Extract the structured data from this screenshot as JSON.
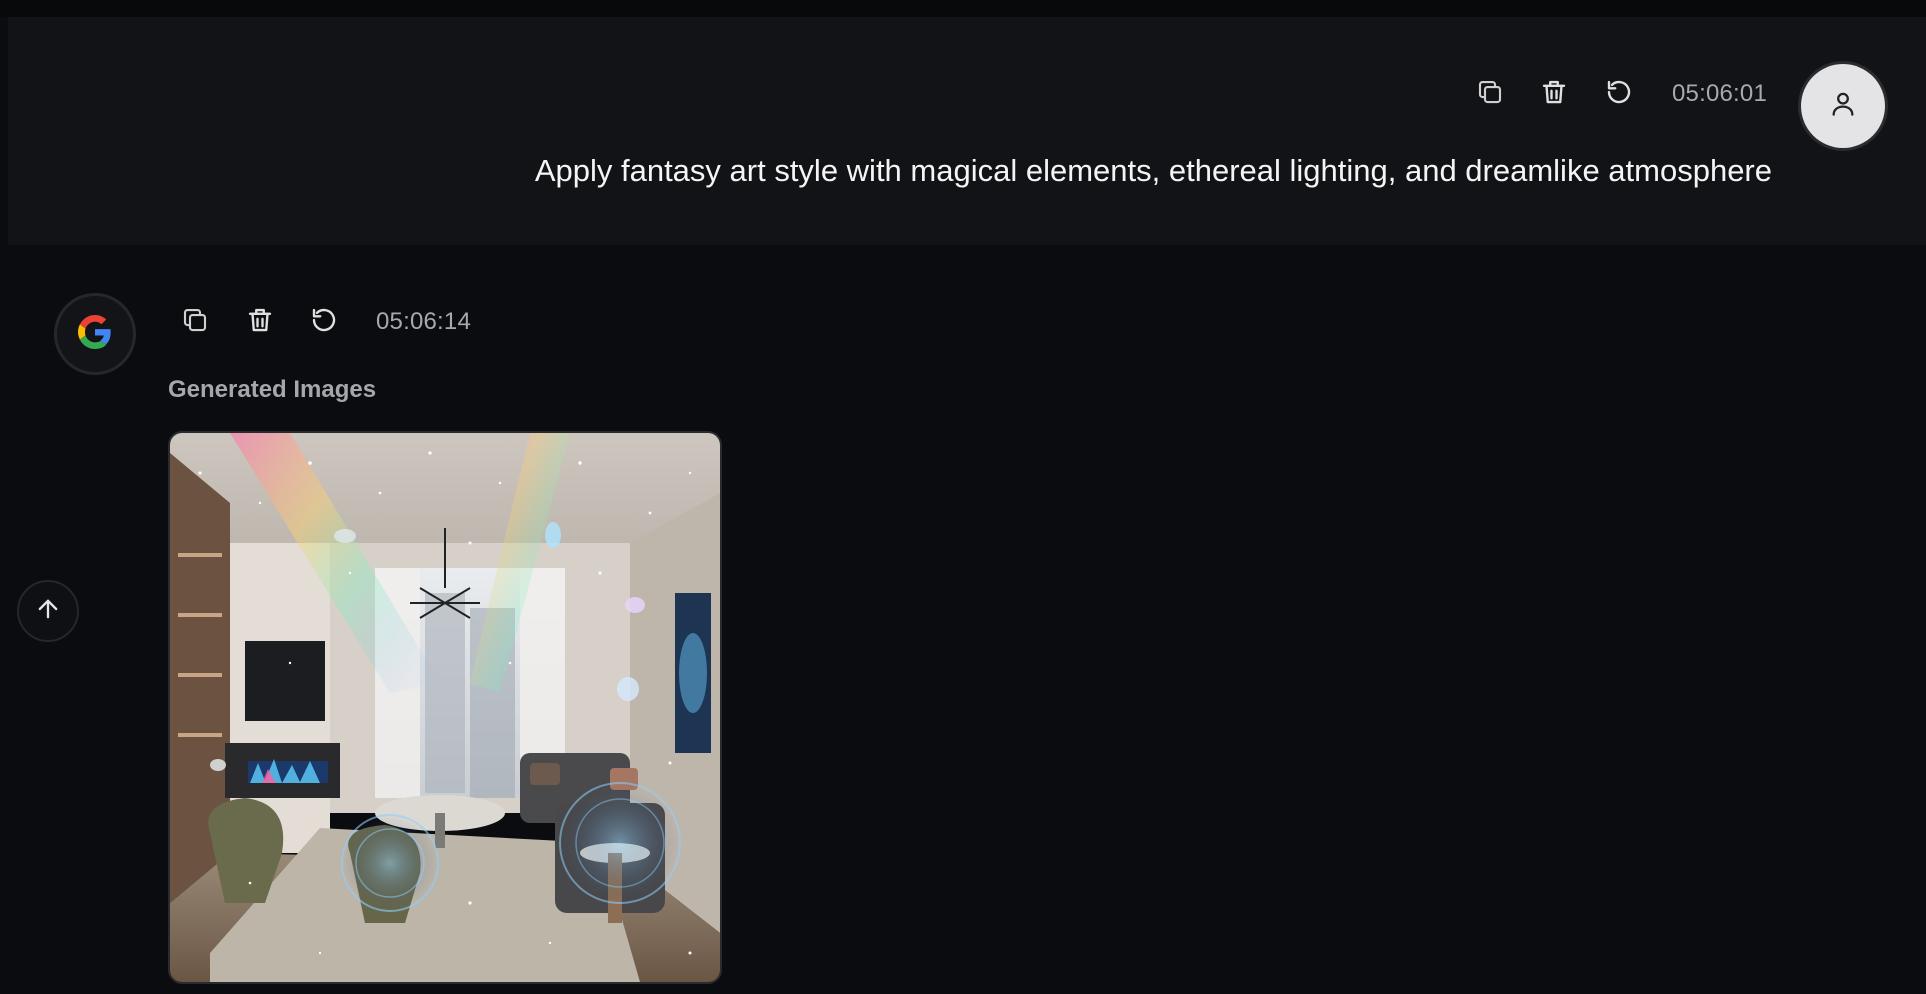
{
  "user_message": {
    "text": "Apply fantasy art style with magical elements, ethereal lighting, and dreamlike atmosphere",
    "timestamp": "05:06:01",
    "actions": {
      "copy_icon": "copy-icon",
      "delete_icon": "trash-icon",
      "retry_icon": "refresh-icon"
    },
    "avatar_icon": "user-icon"
  },
  "assistant_message": {
    "timestamp": "05:06:14",
    "avatar_icon": "google-logo",
    "section_label": "Generated Images",
    "image_description_icon": "generated-image"
  },
  "scroll_button_icon": "arrow-up-icon",
  "colors": {
    "background": "#0b0c0f",
    "user_bubble": "#121316",
    "text": "#f5f5f5",
    "muted": "#a7a9ae"
  }
}
